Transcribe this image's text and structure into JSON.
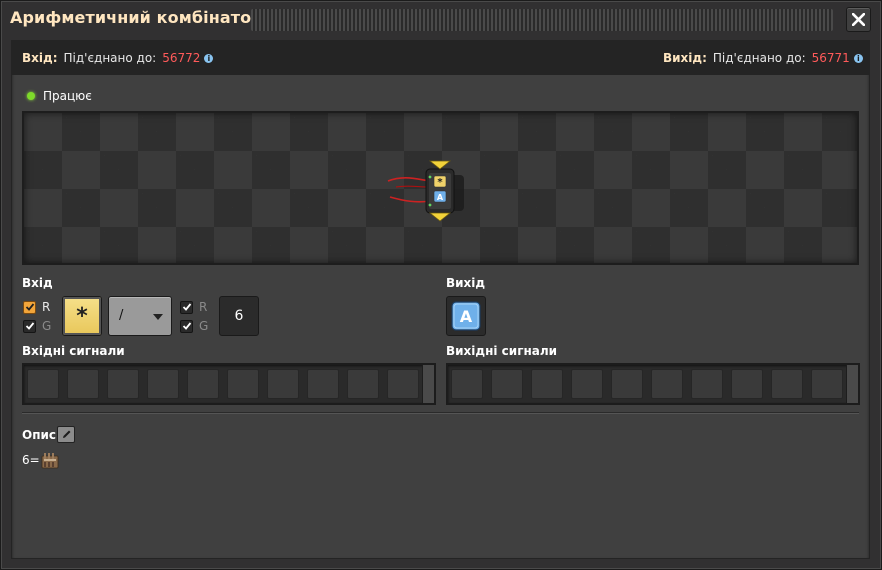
{
  "window": {
    "title": "Арифметичний комбінатор",
    "close_icon": "close-icon"
  },
  "connections": {
    "input_label": "Вхід:",
    "input_connected": "Під'єднано до:",
    "input_network": "56772",
    "output_label": "Вихід:",
    "output_connected": "Під'єднано до:",
    "output_network": "56771"
  },
  "status": {
    "text": "Працює",
    "color": "#7edb2a"
  },
  "input_section": {
    "label": "Вхід",
    "first_signal": {
      "red_label": "R",
      "green_label": "G",
      "red_checked": true,
      "green_checked": true,
      "signal_symbol": "*",
      "signal_icon": "each-signal-icon"
    },
    "operator": "/",
    "second_signal": {
      "red_label": "R",
      "green_label": "G",
      "red_checked": true,
      "green_checked": true,
      "constant": "6"
    }
  },
  "output_section": {
    "label": "Вихід",
    "signal_letter": "A",
    "signal_icon": "signal-a-icon"
  },
  "input_signals": {
    "label": "Вхідні сигнали"
  },
  "output_signals": {
    "label": "Вихідні сигнали"
  },
  "description": {
    "label": "Опис",
    "edit_icon": "pencil-icon",
    "text": "6=",
    "text_icon": "factory-icon"
  },
  "colors": {
    "title": "#ffe6c0",
    "network_id": "#ff5a5a",
    "accent_orange": "#f2a53a",
    "signal_yellow": "#f0d26a",
    "signal_blue": "#6fb0ea"
  }
}
